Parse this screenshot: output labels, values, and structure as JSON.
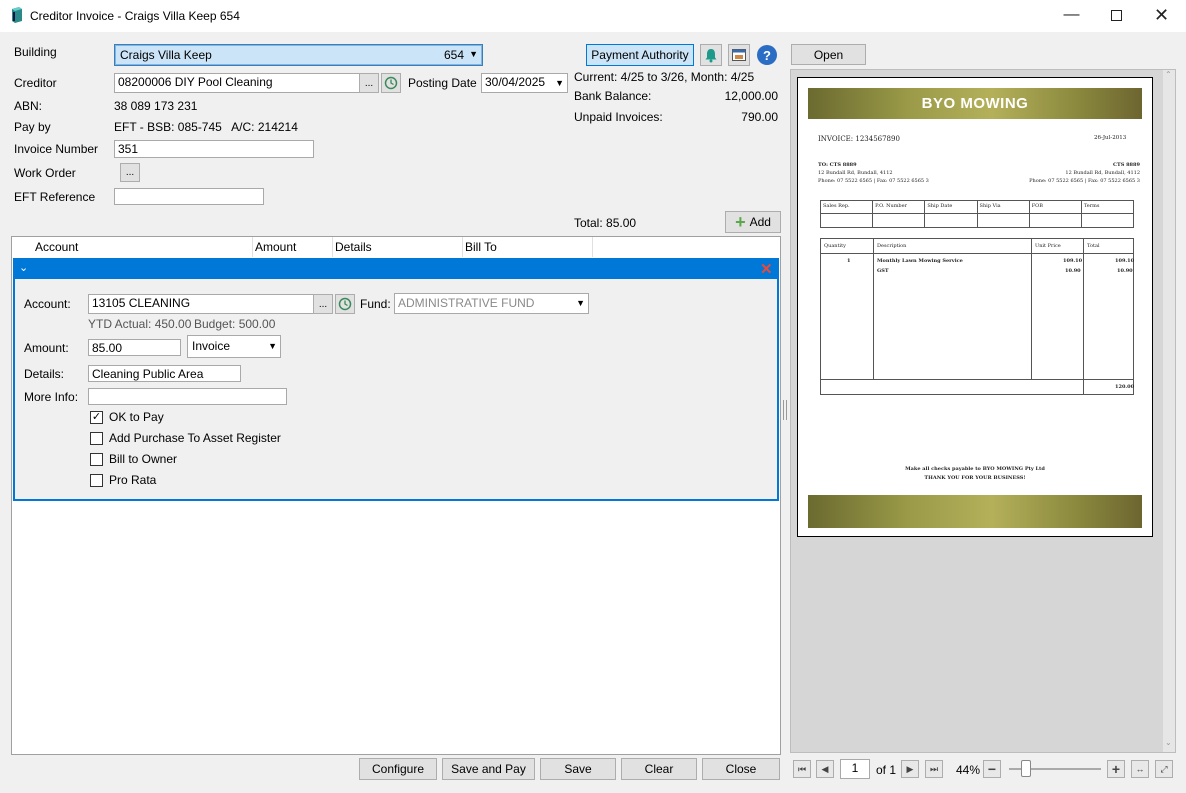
{
  "window": {
    "title": "Creditor Invoice - Craigs Villa Keep 654"
  },
  "form": {
    "building_label": "Building",
    "building_name": "Craigs Villa Keep",
    "building_number": "654",
    "creditor_label": "Creditor",
    "creditor_value": "08200006 DIY Pool Cleaning",
    "posting_date_label": "Posting Date",
    "posting_date_value": "30/04/2025",
    "abn_label": "ABN:",
    "abn_value": "38 089 173 231",
    "payby_label": "Pay by",
    "payby_value": "EFT - BSB: 085-745   A/C: 214214",
    "invoice_number_label": "Invoice Number",
    "invoice_number_value": "351",
    "work_order_label": "Work Order",
    "eft_reference_label": "EFT Reference",
    "eft_reference_value": "",
    "ellipsis": "...",
    "total_text": "Total: 85.00"
  },
  "summary": {
    "payment_authority": "Payment Authority",
    "current_period": "Current: 4/25 to 3/26, Month: 4/25",
    "bank_balance_label": "Bank Balance:",
    "bank_balance_value": "12,000.00",
    "unpaid_label": "Unpaid Invoices:",
    "unpaid_value": "790.00",
    "add_label": "Add"
  },
  "table": {
    "columns": [
      "Account",
      "Amount",
      "Details",
      "Bill To"
    ]
  },
  "line": {
    "account_label": "Account:",
    "account_value": "13105 CLEANING",
    "fund_label": "Fund:",
    "fund_value": "ADMINISTRATIVE FUND",
    "ytd_actual": "YTD Actual: 450.00",
    "budget": "Budget: 500.00",
    "amount_label": "Amount:",
    "amount_value": "85.00",
    "type_value": "Invoice",
    "details_label": "Details:",
    "details_value": "Cleaning Public Area",
    "more_info_label": "More Info:",
    "more_info_value": "",
    "checks": [
      {
        "label": "OK to Pay",
        "checked": true
      },
      {
        "label": "Add Purchase To Asset Register",
        "checked": false
      },
      {
        "label": "Bill to Owner",
        "checked": false
      },
      {
        "label": "Pro Rata",
        "checked": false
      }
    ]
  },
  "footer": {
    "configure": "Configure",
    "save_and_pay": "Save and Pay",
    "save": "Save",
    "clear": "Clear",
    "close": "Close"
  },
  "preview": {
    "open": "Open",
    "page_value": "1",
    "page_of": "of 1",
    "zoom": "44%",
    "invoice": {
      "brand": "BYO MOWING",
      "invoice_no": "INVOICE: 1234567890",
      "date": "26-Jul-2013",
      "to_left_1": "TO:  CTS 8889",
      "to_left_2": "12 Bundall Rd, Bundall, 4112",
      "to_left_3": "Phone: 07 5522 6565  |  Fax: 07 5522 6565 3",
      "to_right_1": "CTS 8889",
      "to_right_2": "12 Bundall Rd, Bundall, 4112",
      "to_right_3": "Phone: 07 5522 6565  |  Fax: 07 5522 6565 3",
      "head_cols": [
        "Sales Rep.",
        "P.O. Number",
        "Ship Date",
        "Ship Via",
        "FOB",
        "Terms"
      ],
      "item_cols": [
        "Quantity",
        "Description",
        "Unit Price",
        "Total"
      ],
      "row1": [
        "1",
        "Monthly Lawn Mowing Service",
        "109.10",
        "109.10"
      ],
      "row2": [
        "",
        "GST",
        "10.90",
        "10.90"
      ],
      "grand_total": "120.00",
      "footer1": "Make all checks payable to BYO MOWING Pty Ltd",
      "footer2": "THANK YOU FOR YOUR BUSINESS!"
    }
  },
  "colors": {
    "accent_blue": "#0078d7",
    "selection_blue": "#cce4f7",
    "add_green": "#5aa84a",
    "help_blue": "#2b6cc4",
    "brand_olive": "#8a8a3a"
  }
}
